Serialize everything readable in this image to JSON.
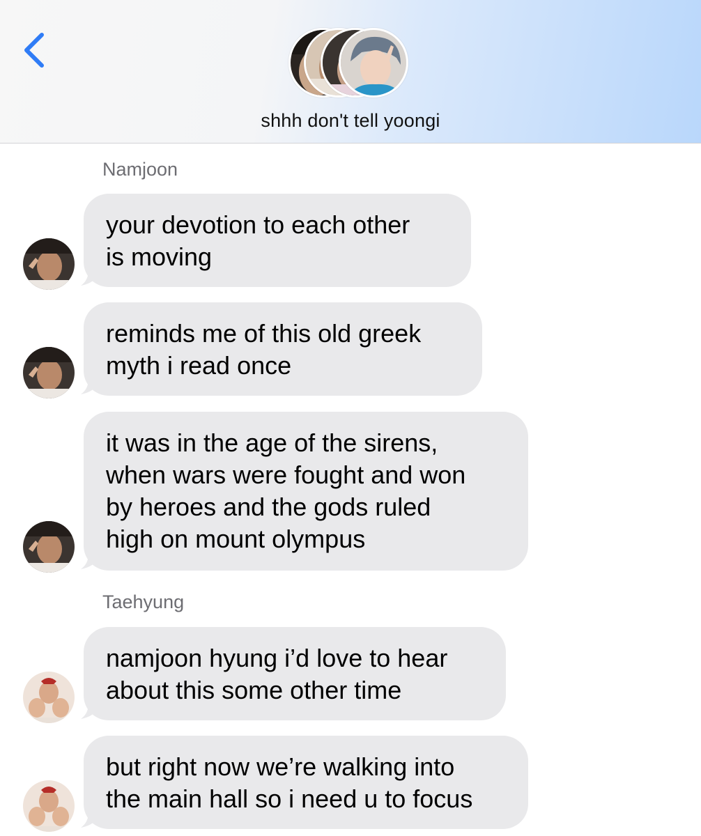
{
  "header": {
    "title": "shhh don't tell yoongi",
    "back_icon": "chevron-left-icon",
    "accent_color": "#2f7cf6",
    "avatars": [
      "group-member-avatar-1",
      "group-member-avatar-2",
      "group-member-avatar-3",
      "group-member-avatar-4"
    ]
  },
  "thread": {
    "bubble_color": "#e9e9eb",
    "groups": [
      {
        "sender": "Namjoon",
        "messages": [
          {
            "lines": [
              "your devotion to each other",
              "is moving"
            ]
          },
          {
            "lines": [
              "reminds me of this old greek",
              "myth i read once"
            ]
          },
          {
            "lines": [
              "it was in the age of the sirens,",
              "when wars were fought and won",
              "by heroes and the gods ruled",
              "high on mount olympus"
            ]
          }
        ]
      },
      {
        "sender": "Taehyung",
        "messages": [
          {
            "lines": [
              "namjoon hyung i’d love to hear",
              "about this some other time"
            ]
          },
          {
            "lines": [
              "but right now we’re walking into",
              "the main hall so i need u to focus"
            ]
          }
        ]
      }
    ]
  }
}
